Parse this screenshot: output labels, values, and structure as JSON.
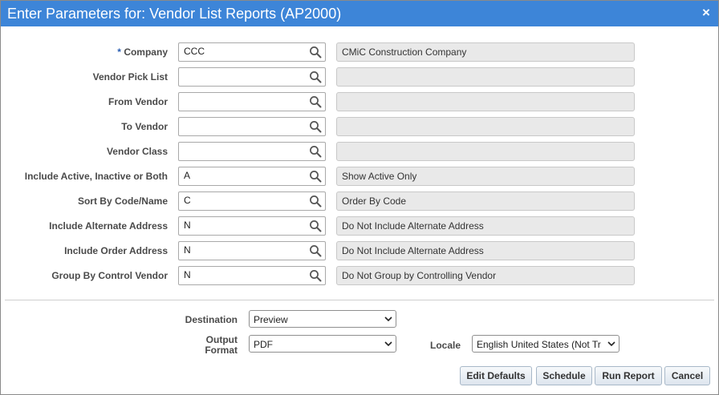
{
  "dialog": {
    "title": "Enter Parameters for: Vendor List Reports (AP2000)",
    "close_glyph": "×"
  },
  "params": [
    {
      "label": "Company",
      "required": true,
      "value": "CCC",
      "description": "CMiC Construction Company"
    },
    {
      "label": "Vendor Pick List",
      "required": false,
      "value": "",
      "description": ""
    },
    {
      "label": "From Vendor",
      "required": false,
      "value": "",
      "description": ""
    },
    {
      "label": "To Vendor",
      "required": false,
      "value": "",
      "description": ""
    },
    {
      "label": "Vendor Class",
      "required": false,
      "value": "",
      "description": ""
    },
    {
      "label": "Include Active, Inactive or Both",
      "required": false,
      "value": "A",
      "description": "Show Active Only"
    },
    {
      "label": "Sort By Code/Name",
      "required": false,
      "value": "C",
      "description": "Order By Code"
    },
    {
      "label": "Include Alternate Address",
      "required": false,
      "value": "N",
      "description": "Do Not Include Alternate Address"
    },
    {
      "label": "Include Order Address",
      "required": false,
      "value": "N",
      "description": "Do Not Include Alternate Address"
    },
    {
      "label": "Group By Control Vendor",
      "required": false,
      "value": "N",
      "description": "Do Not Group by Controlling Vendor"
    }
  ],
  "required_marker": "*",
  "output": {
    "destination_label": "Destination",
    "destination_value": "Preview",
    "format_label_line1": "Output",
    "format_label_line2": "Format",
    "format_value": "PDF",
    "locale_label": "Locale",
    "locale_value": "English United States (Not Tr"
  },
  "buttons": {
    "edit_defaults": "Edit Defaults",
    "schedule": "Schedule",
    "run_report": "Run Report",
    "cancel": "Cancel"
  },
  "icons": {
    "lookup": "search-icon",
    "dropdown": "chevron-down-icon",
    "close": "close-icon"
  },
  "colors": {
    "titlebar": "#3d85d8",
    "required_marker": "#2b5fb3",
    "readonly_field": "#e9e9e9"
  }
}
